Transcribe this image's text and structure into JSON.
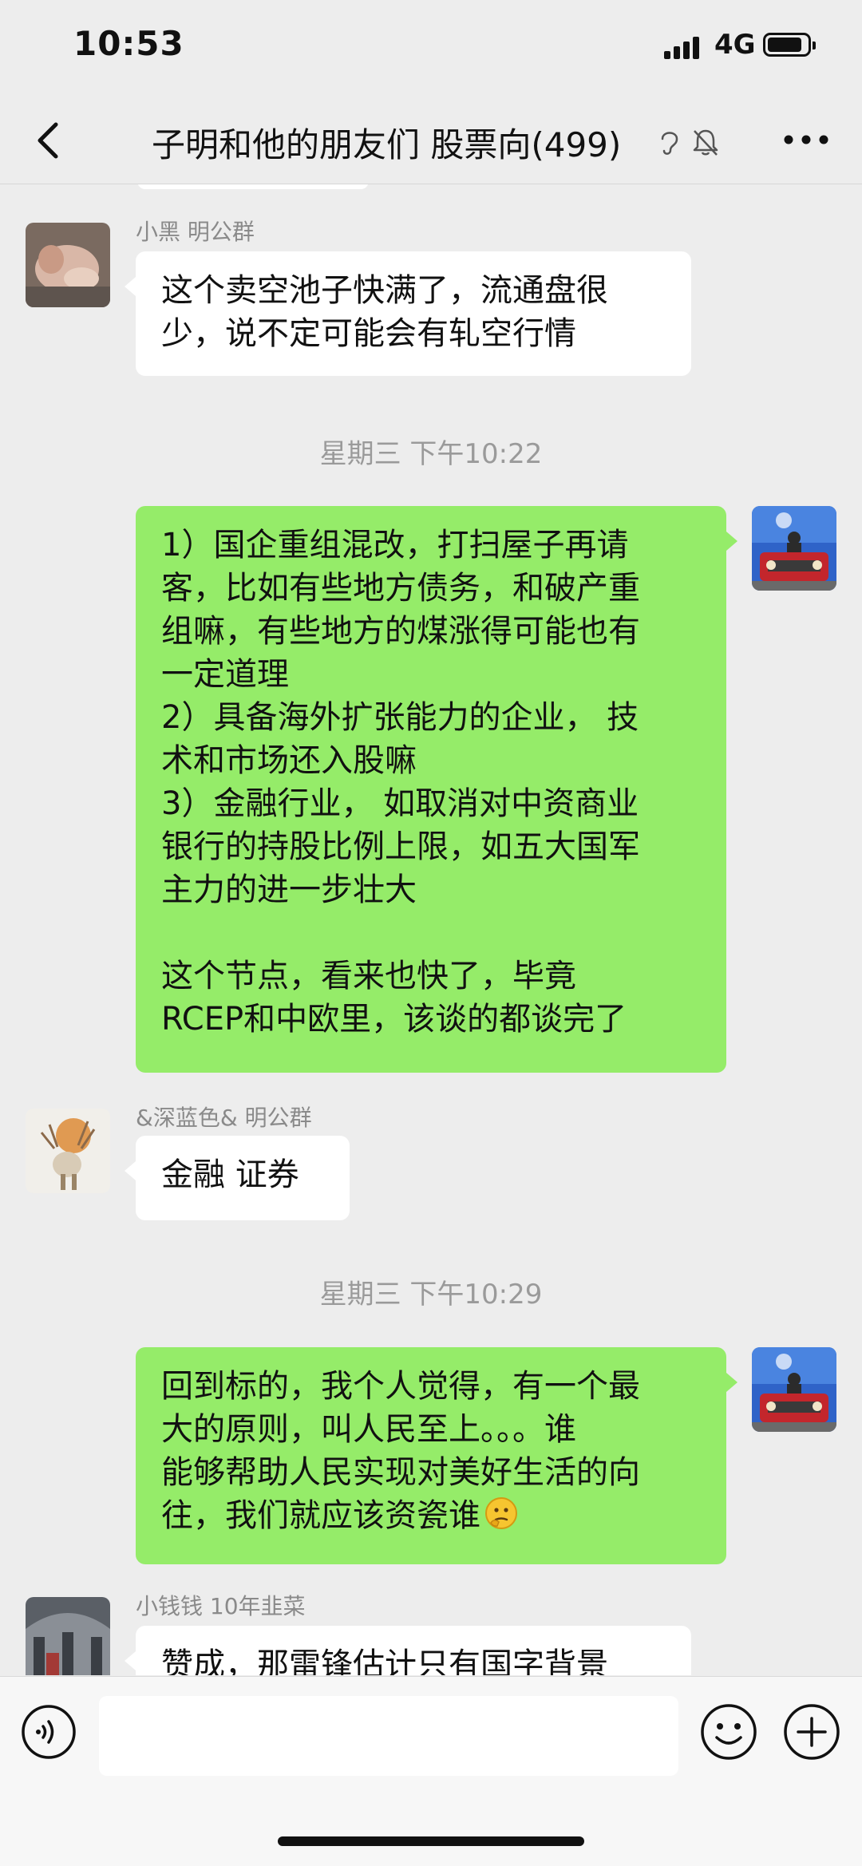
{
  "status_bar": {
    "time": "10:53",
    "network": "4G"
  },
  "nav": {
    "title": "子明和他的朋友们 股票向(499)"
  },
  "messages": [
    {
      "type": "incoming",
      "sender": "小黑 明公群",
      "text": "这个卖空池子快满了，流通盘很\n少，说不定可能会有轧空行情"
    },
    {
      "type": "timestamp",
      "text": "星期三 下午10:22"
    },
    {
      "type": "outgoing",
      "text": "1）国企重组混改，打扫屋子再请\n客，比如有些地方债务，和破产重\n组嘛，有些地方的煤涨得可能也有\n一定道理\n2）具备海外扩张能力的企业， 技\n术和市场还入股嘛\n3）金融行业， 如取消对中资商业\n银行的持股比例上限，如五大国军\n主力的进一步壮大\n\n这个节点，看来也快了，毕竟\nRCEP和中欧里，该谈的都谈完了"
    },
    {
      "type": "incoming",
      "sender": "&深蓝色& 明公群",
      "text": "金融 证券"
    },
    {
      "type": "timestamp",
      "text": "星期三 下午10:29"
    },
    {
      "type": "outgoing",
      "text": "回到标的，我个人觉得，有一个最\n大的原则，叫人民至上。。。谁\n能够帮助人民实现对美好生活的向\n往，我们就应该资瓷谁",
      "emoji": "thinking-face-icon"
    },
    {
      "type": "incoming",
      "sender": "小钱钱 10年韭菜",
      "text": "赞成，那雷锋估计只有国字背景"
    }
  ],
  "input": {
    "value": "",
    "placeholder": ""
  },
  "colors": {
    "background": "#EDEDED",
    "outgoing_bubble": "#95EC69",
    "incoming_bubble": "#FFFFFF",
    "meta_text": "#8A8A8A"
  }
}
